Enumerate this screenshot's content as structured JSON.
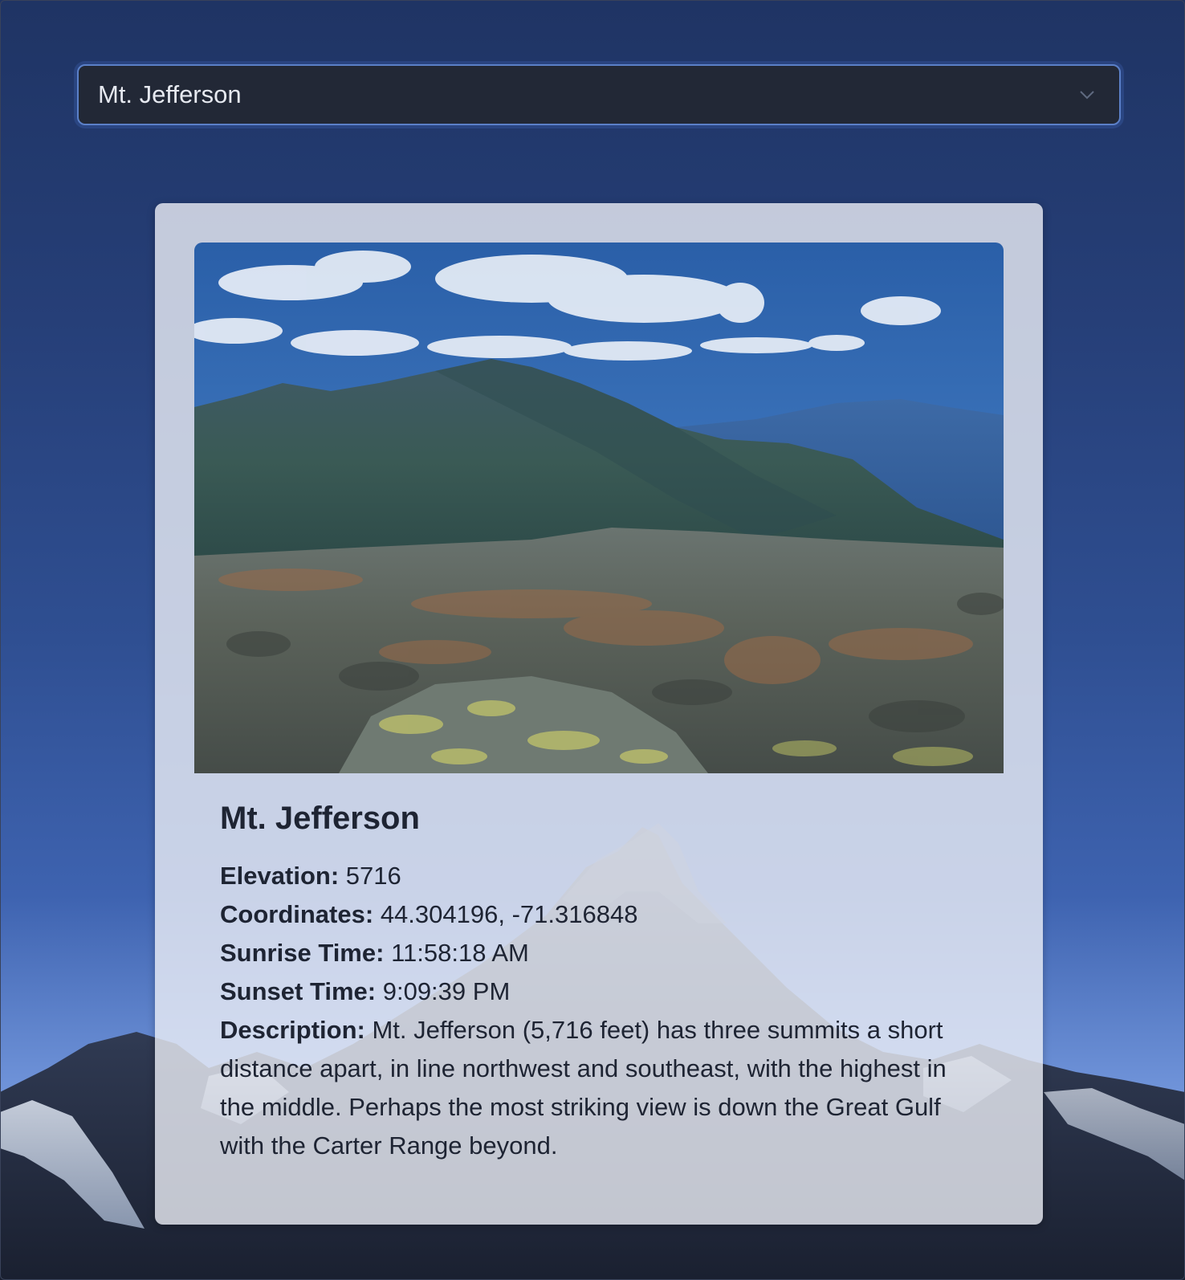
{
  "selector": {
    "selected": "Mt. Jefferson",
    "icon": "chevron-down-icon"
  },
  "peak": {
    "name": "Mt. Jefferson",
    "elevation_label": "Elevation:",
    "elevation": "5716",
    "coordinates_label": "Coordinates:",
    "coordinates": "44.304196, -71.316848",
    "sunrise_label": "Sunrise Time:",
    "sunrise": "11:58:18 AM",
    "sunset_label": "Sunset Time:",
    "sunset": "9:09:39 PM",
    "description_label": "Description:",
    "description": "Mt. Jefferson (5,716 feet) has three summits a short distance apart, in line northwest and southeast, with the highest in the middle. Perhaps the most striking view is down the Great Gulf with the Carter Range beyond."
  },
  "colors": {
    "background_top": "#1f3464",
    "background_bottom": "#9dbbf0",
    "select_bg": "#222836",
    "select_border": "#5b80c8",
    "card_bg": "#eceff6",
    "text": "#1e2433"
  }
}
